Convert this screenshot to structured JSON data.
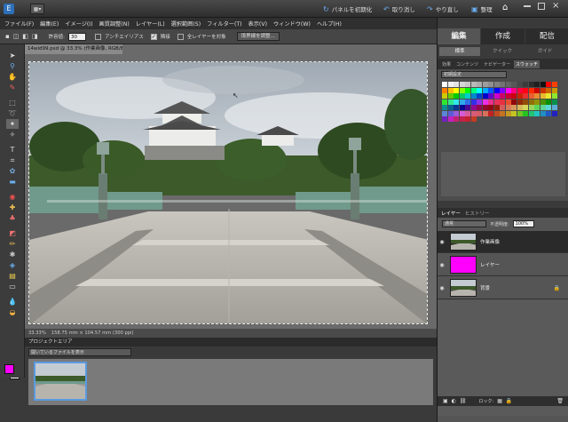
{
  "titlebar": {
    "mode_button": "▦▾",
    "reset_panels": "パネルを初期化",
    "undo": "取り消し",
    "redo": "やり直し",
    "organize": "整理",
    "home_icon": "home-icon"
  },
  "menu": [
    "ファイル(F)",
    "編集(E)",
    "イメージ(I)",
    "画質調整(N)",
    "レイヤー(L)",
    "選択範囲(S)",
    "フィルター(T)",
    "表示(V)",
    "ウィンドウ(W)",
    "ヘルプ(H)"
  ],
  "options": {
    "tolerance_label": "許容値:",
    "tolerance_value": "30",
    "antialias": "アンチエイリアス",
    "contiguous": "隣接",
    "all_layers": "全レイヤーを対象",
    "refine_edge": "境界線を調整..."
  },
  "document": {
    "tab": "14wid99.psd @ 33.3% (作業画像, RGB/8) *"
  },
  "status": {
    "zoom": "33.33%",
    "size": "158.75 mm × 104.57 mm (300 ppi)"
  },
  "project_bin": {
    "header": "プロジェクトエリア",
    "select": "開いているファイルを表示"
  },
  "panels": {
    "tabs": [
      "編集",
      "作成",
      "配信"
    ],
    "subtabs": [
      "標準",
      "クイック",
      "ガイド"
    ],
    "swatch_tabs": [
      "効果",
      "コンテンツ",
      "ナビゲーター",
      "スウォッチ"
    ],
    "swatch_select": "初期設定",
    "layer_tabs": [
      "レイヤー",
      "ヒストリー"
    ],
    "blend_mode": "通常",
    "opacity_label": "不透明度:",
    "opacity_value": "100%",
    "layers": [
      {
        "name": "作業画像",
        "kind": "photo",
        "selected": true,
        "lock": false
      },
      {
        "name": "レイヤー",
        "kind": "magenta",
        "selected": false,
        "lock": false
      },
      {
        "name": "背景",
        "kind": "photo",
        "selected": false,
        "lock": true
      }
    ],
    "lock_label": "ロック:"
  },
  "colors": {
    "foreground": "#ff00ff",
    "background": "#ffffff",
    "accent": "#5a9ae0"
  }
}
